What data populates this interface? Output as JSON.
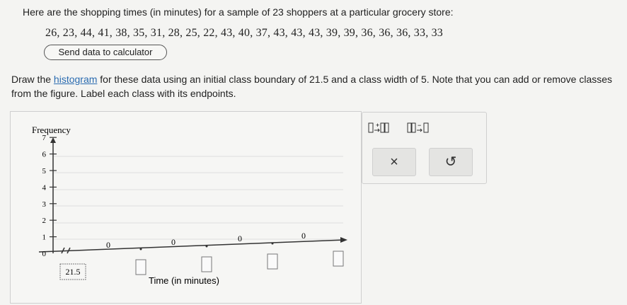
{
  "intro_text": "Here are the shopping times (in minutes) for a sample of 23 shoppers at a particular grocery store:",
  "data_values": "26, 23, 44, 41, 38, 35, 31, 28, 25, 22, 43, 40, 37, 43, 43, 43, 39, 39, 36, 36, 36, 33, 33",
  "send_button_label": "Send data to calculator",
  "instructions": {
    "part1": "Draw the ",
    "link": "histogram",
    "part2": " for these data using an initial class boundary of 21.5 and a class width of 5. Note that you can add or remove classes from the figure. Label each class with its endpoints."
  },
  "graph": {
    "ylabel": "Frequency",
    "xlabel": "Time (in minutes)",
    "y_ticks": [
      "0",
      "1",
      "2",
      "3",
      "4",
      "5",
      "6",
      "7"
    ],
    "first_boundary": "21.5",
    "bar_values": [
      "0",
      "0",
      "0",
      "0"
    ]
  },
  "tools": {
    "add_class_icon": "add-class-icon",
    "remove_class_icon": "remove-class-icon",
    "clear_label": "×",
    "undo_label": "↺"
  }
}
